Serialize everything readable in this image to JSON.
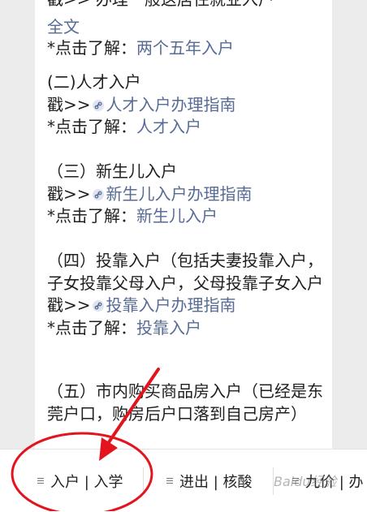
{
  "article": {
    "sec_full": {
      "line_cut": "戳>>  办理一般这居住就业入户",
      "line_full": "全文",
      "prefix": "*点击了解：",
      "link": "两个五年入户"
    },
    "sec2": {
      "heading": "(二)人才入户",
      "prefix_poke": "戳>>",
      "guide_link": "人才入户办理指南",
      "prefix_more": "*点击了解：",
      "more_link": "人才入户"
    },
    "sec3": {
      "heading": "（三）新生儿入户",
      "prefix_poke": "戳>>",
      "guide_link": "新生儿入户办理指南",
      "prefix_more": "*点击了解：",
      "more_link": "新生儿入户"
    },
    "sec4": {
      "heading": "（四）投靠入户（包括夫妻投靠入户，子女投靠父母入户，父母投靠子女入户",
      "prefix_poke": "戳>>",
      "guide_link": "投靠入户办理指南",
      "prefix_more": "*点击了解：",
      "more_link": "投靠入户"
    },
    "sec5": {
      "heading": "（五）市内购买商品房入户（已经是东莞户口，购房后户口落到自己房产）"
    }
  },
  "bottom_menu": {
    "item1": "入户 | 入学",
    "item2": "进出 | 核酸",
    "item3": "九价 | 办"
  },
  "watermark": "Baidu经验",
  "colors": {
    "link": "#576b95",
    "annotation": "#e4141e",
    "text": "#1f1f1f"
  }
}
